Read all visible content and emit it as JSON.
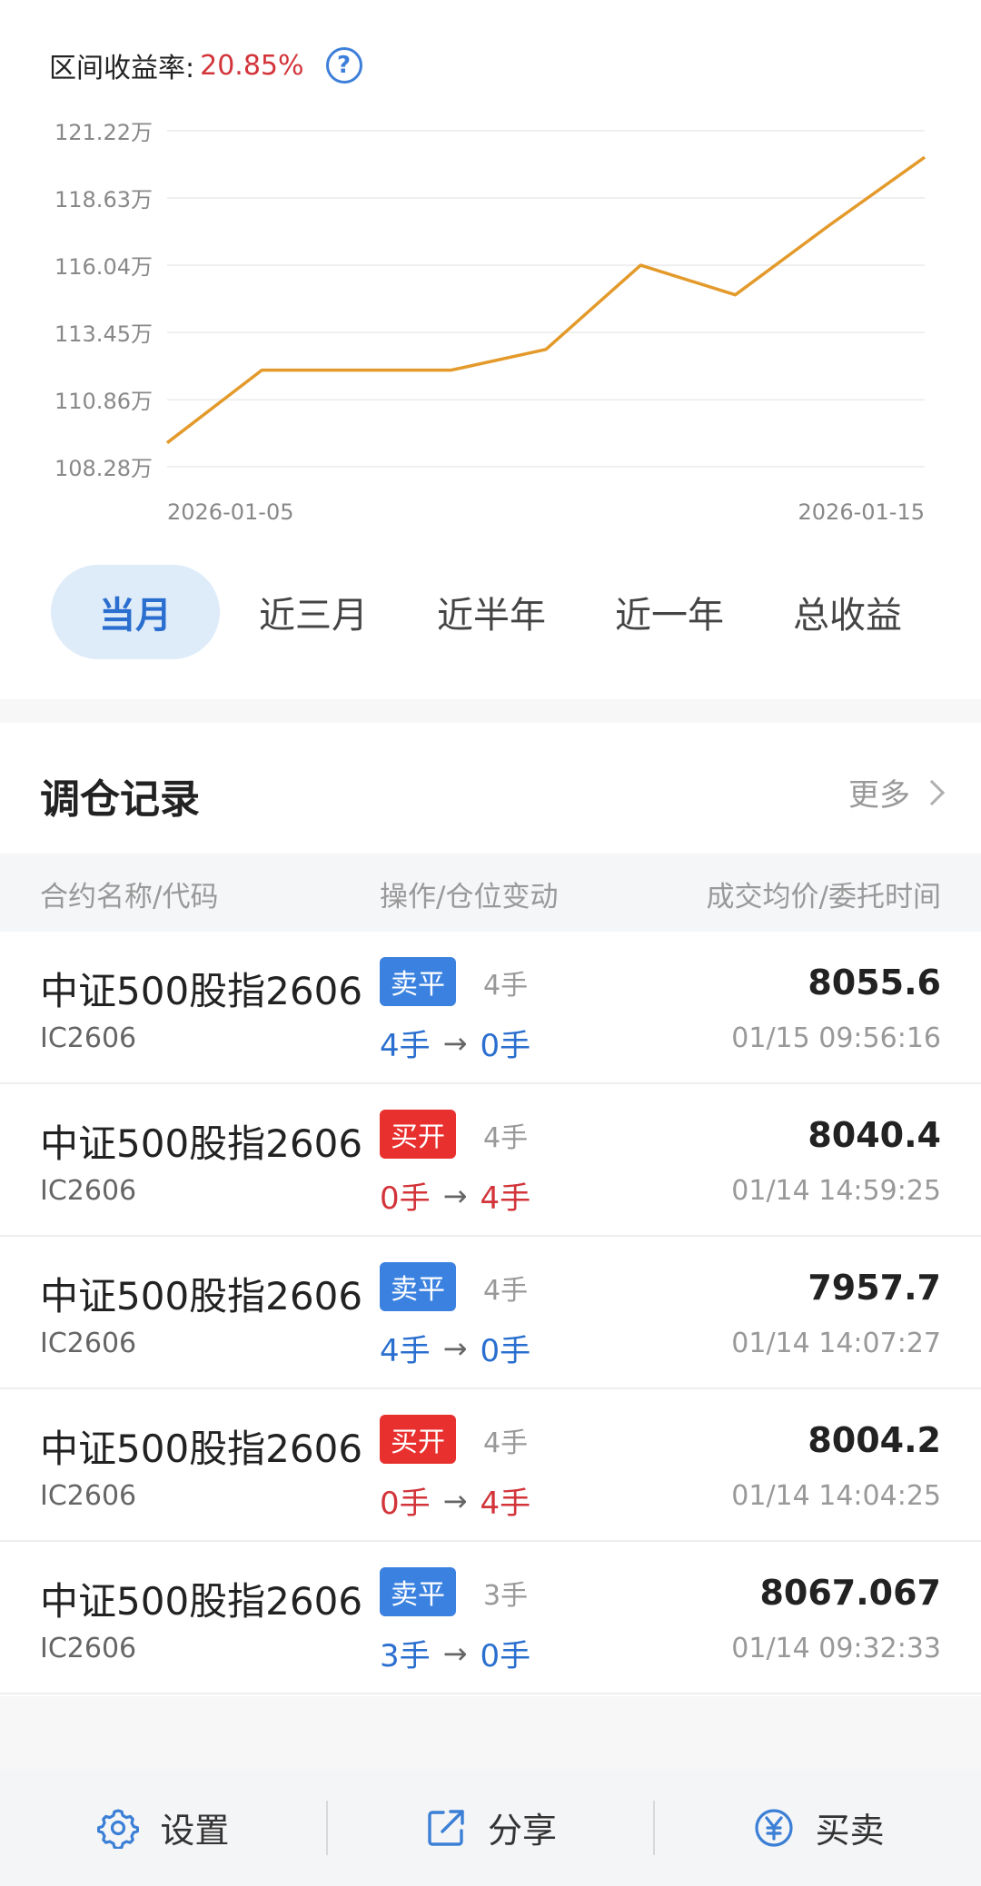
{
  "header": {
    "return_label": "区间收益率:",
    "return_value": "20.85%",
    "help_icon": "question-circle-icon"
  },
  "chart_data": {
    "type": "line",
    "y_tick_labels": [
      "121.22万",
      "118.63万",
      "116.04万",
      "113.45万",
      "110.86万",
      "108.28万"
    ],
    "y_ticks": [
      121.22,
      118.63,
      116.04,
      113.45,
      110.86,
      108.28
    ],
    "ylim": [
      108.28,
      121.22
    ],
    "x_tick_labels": [
      "2026-01-05",
      "2026-01-15"
    ],
    "grid": true,
    "line_color": "#e39a2b",
    "series": [
      {
        "values": [
          109.2,
          112.0,
          112.0,
          112.0,
          112.8,
          116.04,
          114.9,
          117.6,
          120.2
        ]
      }
    ]
  },
  "period_tabs": [
    "当月",
    "近三月",
    "近半年",
    "近一年",
    "总收益"
  ],
  "period_active_index": 0,
  "records": {
    "title": "调仓记录",
    "more_label": "更多",
    "columns": [
      "合约名称/代码",
      "操作/仓位变动",
      "成交均价/委托时间"
    ],
    "rows": [
      {
        "name": "中证500股指2606",
        "code": "IC2606",
        "action": "卖平",
        "action_type": "sell",
        "lots": "4手",
        "from": "4手",
        "to": "0手",
        "price": "8055.6",
        "time": "01/15 09:56:16"
      },
      {
        "name": "中证500股指2606",
        "code": "IC2606",
        "action": "买开",
        "action_type": "buy",
        "lots": "4手",
        "from": "0手",
        "to": "4手",
        "price": "8040.4",
        "time": "01/14 14:59:25"
      },
      {
        "name": "中证500股指2606",
        "code": "IC2606",
        "action": "卖平",
        "action_type": "sell",
        "lots": "4手",
        "from": "4手",
        "to": "0手",
        "price": "7957.7",
        "time": "01/14 14:07:27"
      },
      {
        "name": "中证500股指2606",
        "code": "IC2606",
        "action": "买开",
        "action_type": "buy",
        "lots": "4手",
        "from": "0手",
        "to": "4手",
        "price": "8004.2",
        "time": "01/14 14:04:25"
      },
      {
        "name": "中证500股指2606",
        "code": "IC2606",
        "action": "卖平",
        "action_type": "sell",
        "lots": "3手",
        "from": "3手",
        "to": "0手",
        "price": "8067.067",
        "time": "01/14 09:32:33"
      }
    ]
  },
  "bottom_bar": [
    {
      "label": "设置",
      "icon": "gear-icon"
    },
    {
      "label": "分享",
      "icon": "share-icon"
    },
    {
      "label": "买卖",
      "icon": "yuan-circle-icon"
    }
  ],
  "colors": {
    "red": "#d2343a",
    "blue": "#2a6fcf",
    "accent_line": "#e39a2b"
  }
}
